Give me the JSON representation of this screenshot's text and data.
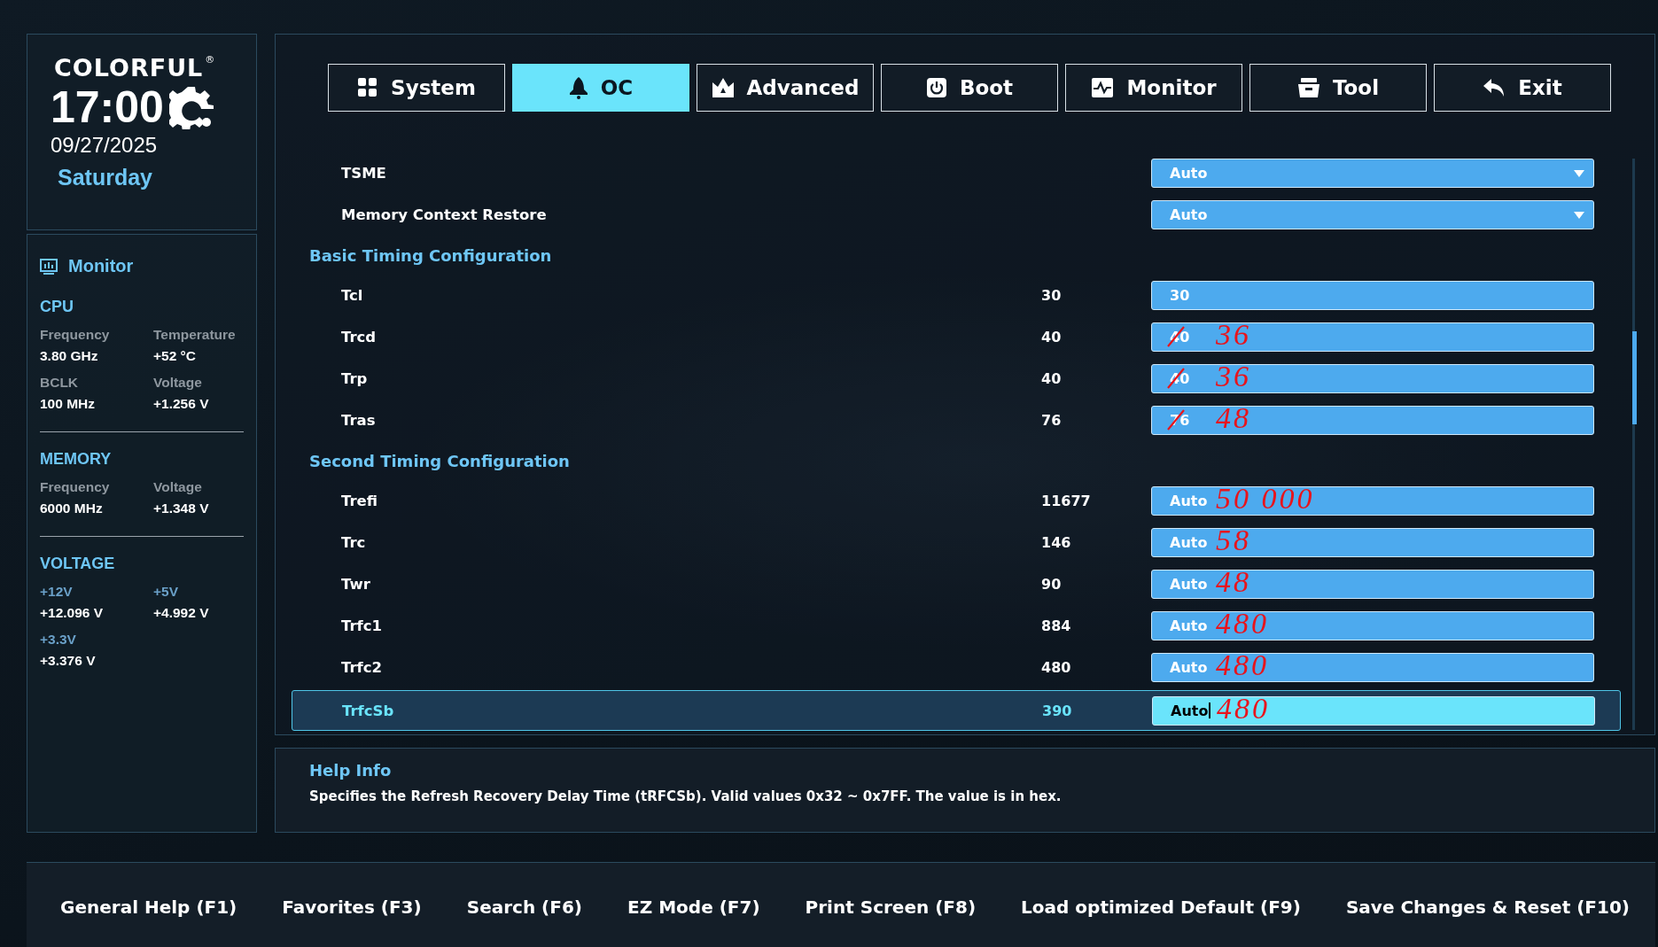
{
  "brand": {
    "logo": "COLORFUL",
    "mark": "®"
  },
  "clock": {
    "time": "17:00",
    "date": "09/27/2025",
    "day": "Saturday"
  },
  "monitor": {
    "title": "Monitor",
    "sections": [
      {
        "title": "CPU",
        "items": [
          {
            "label": "Frequency",
            "value": "3.80 GHz"
          },
          {
            "label": "Temperature",
            "value": "+52 °C"
          },
          {
            "label": "BCLK",
            "value": "100 MHz"
          },
          {
            "label": "Voltage",
            "value": "+1.256 V"
          }
        ]
      },
      {
        "title": "MEMORY",
        "items": [
          {
            "label": "Frequency",
            "value": "6000 MHz"
          },
          {
            "label": "Voltage",
            "value": "+1.348 V"
          }
        ]
      },
      {
        "title": "VOLTAGE",
        "items": [
          {
            "label": "+12V",
            "value": "+12.096 V"
          },
          {
            "label": "+5V",
            "value": "+4.992 V"
          },
          {
            "label": "+3.3V",
            "value": "+3.376 V"
          }
        ]
      }
    ]
  },
  "tabs": [
    {
      "label": "System",
      "selected": false
    },
    {
      "label": "OC",
      "selected": true
    },
    {
      "label": "Advanced",
      "selected": false
    },
    {
      "label": "Boot",
      "selected": false
    },
    {
      "label": "Monitor",
      "selected": false
    },
    {
      "label": "Tool",
      "selected": false
    },
    {
      "label": "Exit",
      "selected": false
    }
  ],
  "settings": [
    {
      "kind": "dropdown",
      "label": "TSME",
      "value": "Auto",
      "selected": false
    },
    {
      "kind": "dropdown",
      "label": "Memory Context Restore",
      "value": "Auto",
      "selected": false
    },
    {
      "kind": "heading",
      "label": "Basic Timing Configuration"
    },
    {
      "kind": "number",
      "label": "Tcl",
      "current": "30",
      "value": "30",
      "selected": false
    },
    {
      "kind": "number",
      "label": "Trcd",
      "current": "40",
      "value": "40",
      "struck": true,
      "note": "36",
      "selected": false
    },
    {
      "kind": "number",
      "label": "Trp",
      "current": "40",
      "value": "40",
      "struck": true,
      "note": "36",
      "selected": false
    },
    {
      "kind": "number",
      "label": "Tras",
      "current": "76",
      "value": "76",
      "struck": true,
      "note": "48",
      "selected": false
    },
    {
      "kind": "heading",
      "label": "Second Timing Configuration"
    },
    {
      "kind": "number",
      "label": "Trefi",
      "current": "11677",
      "value": "Auto",
      "note": "50 000",
      "selected": false
    },
    {
      "kind": "number",
      "label": "Trc",
      "current": "146",
      "value": "Auto",
      "note": "58",
      "selected": false
    },
    {
      "kind": "number",
      "label": "Twr",
      "current": "90",
      "value": "Auto",
      "note": "48",
      "selected": false
    },
    {
      "kind": "number",
      "label": "Trfc1",
      "current": "884",
      "value": "Auto",
      "note": "480",
      "selected": false
    },
    {
      "kind": "number",
      "label": "Trfc2",
      "current": "480",
      "value": "Auto",
      "note": "480",
      "selected": false
    },
    {
      "kind": "number",
      "label": "TrfcSb",
      "current": "390",
      "value": "Auto",
      "note": "480",
      "selected": true
    }
  ],
  "help": {
    "title": "Help Info",
    "text": "Specifies the Refresh Recovery Delay Time (tRFCSb). Valid values 0x32 ~ 0x7FF. The value is in hex."
  },
  "footer": [
    "General Help (F1)",
    "Favorites (F3)",
    "Search (F6)",
    "EZ Mode (F7)",
    "Print Screen (F8)",
    "Load optimized Default (F9)",
    "Save Changes & Reset (F10)"
  ]
}
